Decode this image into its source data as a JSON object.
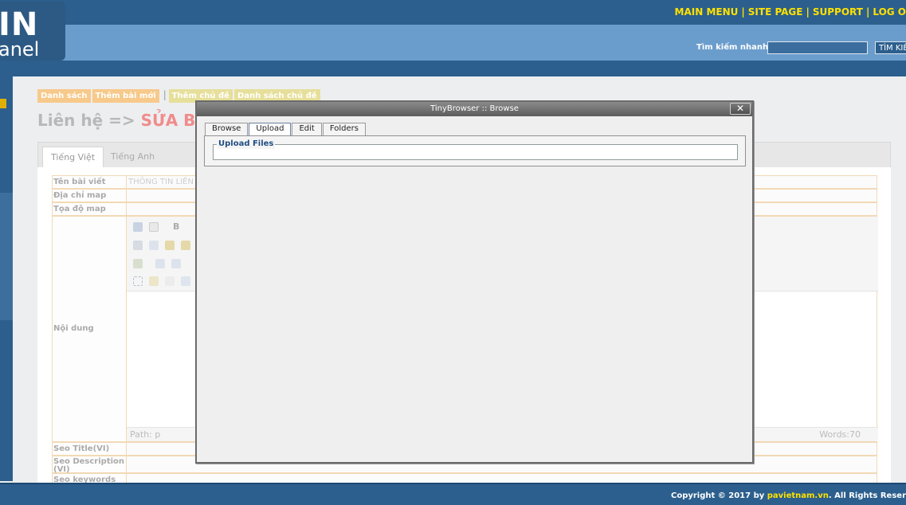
{
  "header": {
    "logo_line1": "IN",
    "logo_line2": "anel",
    "nav": [
      "MAIN MENU",
      "SITE PAGE",
      "SUPPORT",
      "LOG O"
    ],
    "nav_separator": "|",
    "search_label": "Tìm kiếm nhanh",
    "search_button": "TÌM KIẾ"
  },
  "breadcrumbs": {
    "items": [
      "Danh sách",
      "Thêm bài mới",
      "Thêm chủ đề",
      "Danh sách chủ đề"
    ],
    "separator": "|"
  },
  "page_title": {
    "prefix": "Liên hệ =>",
    "action": "SỬA BA"
  },
  "content_tabs": [
    "Tiếng Việt",
    "Tiếng Anh"
  ],
  "form": {
    "rows": [
      {
        "label": "Tên bài viết",
        "value": "THÔNG TIN LIÊN"
      },
      {
        "label": "Địa chỉ map",
        "value": ""
      },
      {
        "label": "Tọa độ map",
        "value": ""
      },
      {
        "label": "Nội dung",
        "value": ""
      },
      {
        "label": "Seo Title(VI)",
        "value": ""
      },
      {
        "label": "Seo Description (VI)",
        "value": ""
      },
      {
        "label": "Seo keywords",
        "value": ""
      }
    ],
    "editor_path": "Path: p",
    "editor_words": "Words:70"
  },
  "dialog": {
    "title": "TinyBrowser :: Browse",
    "close_label": "✕",
    "tabs": [
      "Browse",
      "Upload",
      "Edit",
      "Folders"
    ],
    "active_tab": "Upload",
    "legend": "Upload Files"
  },
  "footer": {
    "prefix": "Copyright © 2017 by ",
    "site": "pavietnam.vn",
    "suffix": ". All Rights Reser"
  },
  "colors": {
    "header_dark": "#2c5f8d",
    "header_band": "#6b9dcc",
    "nav_yellow": "#ffe100",
    "crumb_orange": "#f7c98a",
    "title_red": "#f08c8c"
  }
}
